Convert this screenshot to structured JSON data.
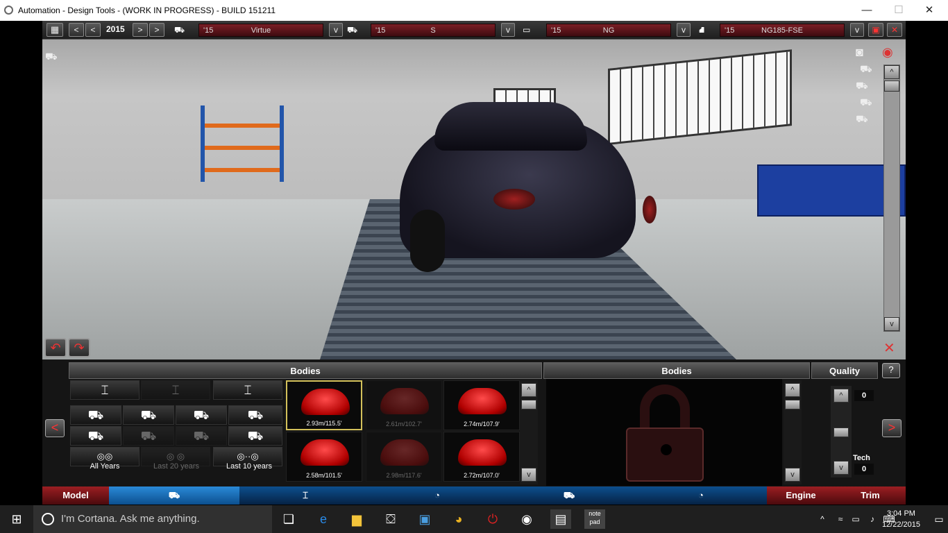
{
  "window": {
    "title": "Automation - Design Tools - (WORK IN PROGRESS) - BUILD 151211",
    "minimize": "—",
    "maximize": "☐",
    "close": "✕"
  },
  "topbar": {
    "year": "2015",
    "selectors": [
      {
        "year": "'15",
        "name": "Virtue",
        "icon": "car-model-icon"
      },
      {
        "year": "'15",
        "name": "S",
        "icon": "car-body-icon"
      },
      {
        "year": "'15",
        "name": "NG",
        "icon": "chassis-icon"
      },
      {
        "year": "'15",
        "name": "NG185-FSE",
        "icon": "engine-icon"
      }
    ],
    "prev": "<",
    "next": ">",
    "dropdown": "v"
  },
  "panel": {
    "left_header": "Bodies",
    "center_header": "Bodies",
    "quality_header": "Quality",
    "help": "?",
    "filters": [
      {
        "label": "All Years"
      },
      {
        "label": "Last 20 years"
      },
      {
        "label": "Last 10 years"
      }
    ],
    "bodies": [
      {
        "caption": "2.93m/115.5'",
        "selected": true,
        "locked": false
      },
      {
        "caption": "2.61m/102.7'",
        "selected": false,
        "locked": true
      },
      {
        "caption": "2.74m/107.9'",
        "selected": false,
        "locked": false
      },
      {
        "caption": "2.58m/101.5'",
        "selected": false,
        "locked": false
      },
      {
        "caption": "2.98m/117.6'",
        "selected": false,
        "locked": true
      },
      {
        "caption": "2.72m/107.0'",
        "selected": false,
        "locked": false
      }
    ],
    "quality_value": "0",
    "tech_label": "Tech",
    "tech_value": "0",
    "up": "^",
    "down": "v"
  },
  "bottom_nav": {
    "model": "Model",
    "engine": "Engine",
    "trim": "Trim"
  },
  "taskbar": {
    "search_placeholder": "I'm Cortana. Ask me anything.",
    "time": "3:04 PM",
    "date": "12/22/2015"
  }
}
